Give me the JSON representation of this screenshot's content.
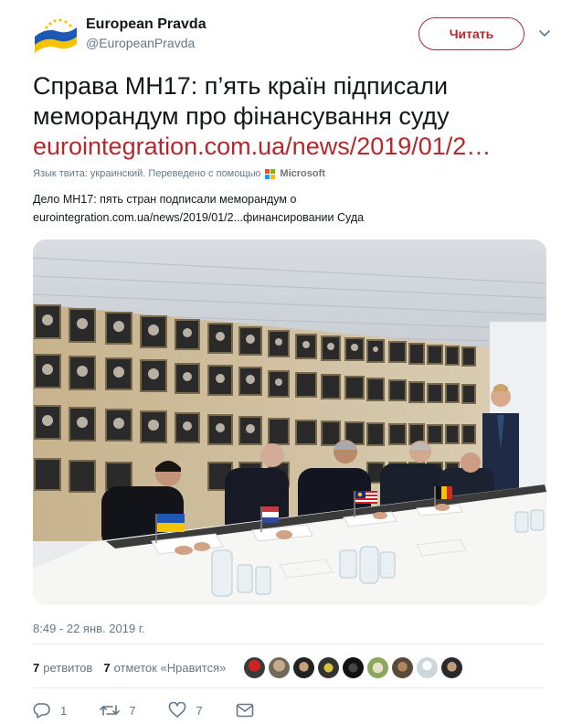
{
  "author": {
    "name": "European Pravda",
    "handle": "@EuropeanPravda",
    "follow_label": "Читать"
  },
  "tweet": {
    "text": "Справа MH17: п’ять країн підписали меморандум про фінансування суду",
    "link": "eurointegration.com.ua/news/2019/01/2…"
  },
  "translation": {
    "meta": "Язык твита: украинский. Переведено с помощью",
    "provider": "Microsoft",
    "text": "Дело MH17: пять стран подписали меморандум о eurointegration.com.ua/news/2019/01/2...финансировании Суда"
  },
  "timestamp": "8:49 - 22 янв. 2019 г.",
  "stats": {
    "retweets_count": "7",
    "retweets_label": "ретвитов",
    "likes_count": "7",
    "likes_label": "отметок «Нравится»"
  },
  "actions": {
    "reply_count": "1",
    "retweet_count": "7",
    "like_count": "7"
  },
  "colors": {
    "accent": "#b3282d",
    "secondary_text": "#657786"
  }
}
